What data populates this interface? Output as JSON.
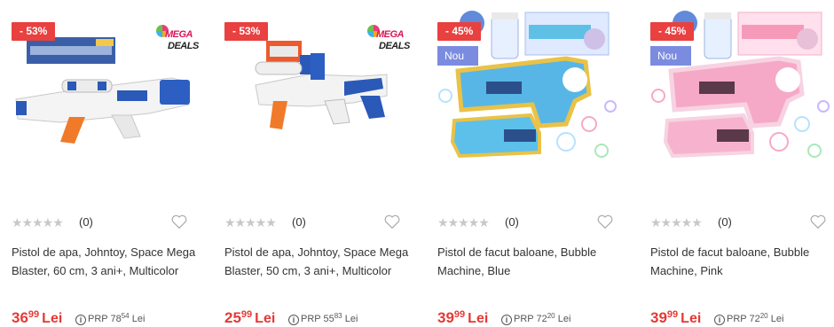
{
  "products": [
    {
      "discount": "- 53%",
      "new_label": "",
      "mega_deals": {
        "line1": "MEGA",
        "line2": "DEALS"
      },
      "image_icon": "water-gun-white-blue-orange",
      "rating_count": "(0)",
      "title": "Pistol de apa, Johntoy, Space Mega Blaster, 60 cm, 3 ani+, Multicolor",
      "price_int": "36",
      "price_dec": "99",
      "currency": "Lei",
      "prp_label": "PRP",
      "prp_int": "78",
      "prp_dec": "54",
      "prp_currency": "Lei"
    },
    {
      "discount": "- 53%",
      "new_label": "",
      "mega_deals": {
        "line1": "MEGA",
        "line2": "DEALS"
      },
      "image_icon": "water-gun-blue-white-orange",
      "rating_count": "(0)",
      "title": "Pistol de apa, Johntoy, Space Mega Blaster, 50 cm, 3 ani+, Multicolor",
      "price_int": "25",
      "price_dec": "99",
      "currency": "Lei",
      "prp_label": "PRP",
      "prp_int": "55",
      "prp_dec": "83",
      "prp_currency": "Lei"
    },
    {
      "discount": "- 45%",
      "new_label": "Nou",
      "image_icon": "bubble-machine-blue",
      "rating_count": "(0)",
      "title": "Pistol de facut baloane, Bubble Machine, Blue",
      "price_int": "39",
      "price_dec": "99",
      "currency": "Lei",
      "prp_label": "PRP",
      "prp_int": "72",
      "prp_dec": "20",
      "prp_currency": "Lei"
    },
    {
      "discount": "- 45%",
      "new_label": "Nou",
      "image_icon": "bubble-machine-pink",
      "rating_count": "(0)",
      "title": "Pistol de facut baloane, Bubble Machine, Pink",
      "price_int": "39",
      "price_dec": "99",
      "currency": "Lei",
      "prp_label": "PRP",
      "prp_int": "72",
      "prp_dec": "20",
      "prp_currency": "Lei"
    }
  ],
  "stars_glyph": "★★★★★",
  "colors": {
    "discount_badge": "#e94040",
    "new_badge": "#7b8ce0",
    "price": "#e53935",
    "stars_empty": "#c8c8c8"
  }
}
